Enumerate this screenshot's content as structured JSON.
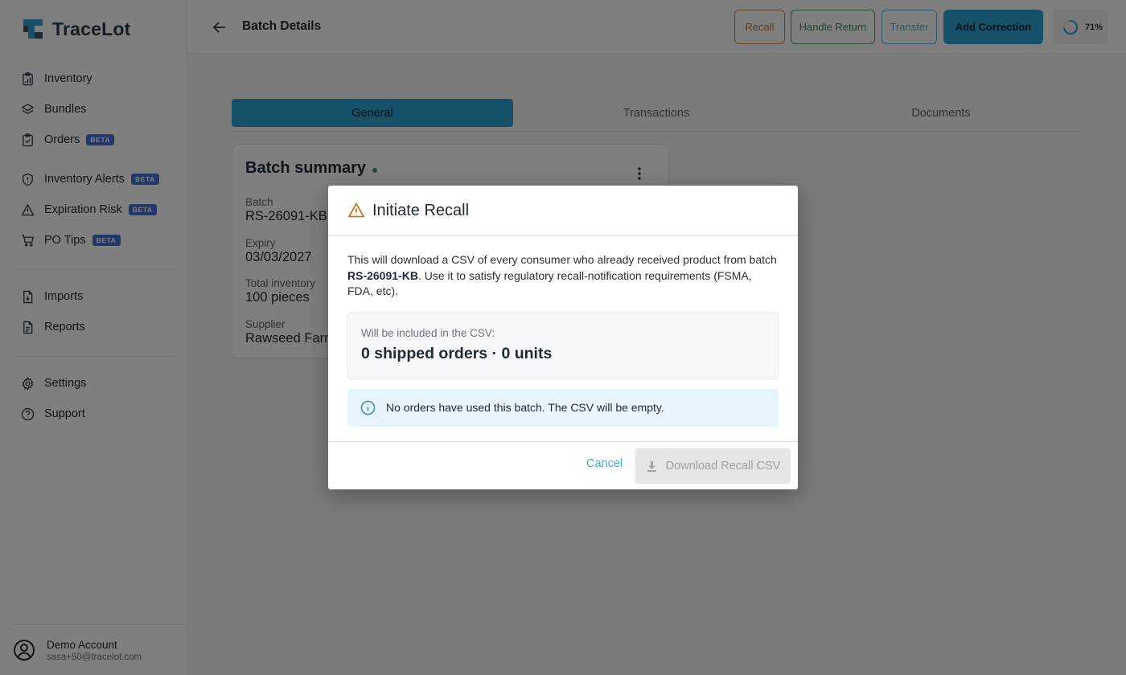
{
  "app": {
    "name": "TraceLot"
  },
  "sidebar": {
    "groups": [
      [
        {
          "label": "Inventory",
          "icon": "clipboard-icon",
          "beta": false
        },
        {
          "label": "Bundles",
          "icon": "layers-icon",
          "beta": false
        },
        {
          "label": "Orders",
          "icon": "clipboard-check-icon",
          "beta": true
        }
      ],
      [
        {
          "label": "Inventory Alerts",
          "icon": "shield-icon",
          "beta": true
        },
        {
          "label": "Expiration Risk",
          "icon": "warning-icon",
          "beta": true
        },
        {
          "label": "PO Tips",
          "icon": "cart-icon",
          "beta": true
        }
      ],
      [
        {
          "label": "Imports",
          "icon": "file-import-icon",
          "beta": false
        },
        {
          "label": "Reports",
          "icon": "file-report-icon",
          "beta": false
        }
      ],
      [
        {
          "label": "Settings",
          "icon": "gear-icon",
          "beta": false
        },
        {
          "label": "Support",
          "icon": "help-icon",
          "beta": false
        }
      ]
    ],
    "beta_label": "BETA",
    "account": {
      "name": "Demo Account",
      "email": "sasa+50@tracelot.com"
    }
  },
  "header": {
    "title": "Batch Details",
    "buttons": {
      "recall": "Recall",
      "handle_return": "Handle Return",
      "transfer": "Transfer",
      "add_correction": "Add Correction"
    },
    "progress": {
      "value": 71,
      "label": "71%"
    }
  },
  "tabs": {
    "general": "General",
    "transactions": "Transactions",
    "documents": "Documents"
  },
  "card": {
    "title": "Batch summary",
    "fields": {
      "batch": {
        "label": "Batch",
        "value": "RS-26091-KB"
      },
      "expiry": {
        "label": "Expiry",
        "value": "03/03/2027"
      },
      "inventory": {
        "label": "Total inventory",
        "value": "100 pieces"
      },
      "supplier": {
        "label": "Supplier",
        "value": "Rawseed Farm"
      }
    }
  },
  "modal": {
    "title": "Initiate Recall",
    "desc_before": "This will download a CSV of every consumer who already received product from batch ",
    "desc_batch": "RS-26091-KB",
    "desc_after": ". Use it to satisfy regulatory recall-notification requirements (FSMA, FDA, etc).",
    "summary_label": "Will be included in the CSV:",
    "summary_value": "0 shipped orders · 0 units",
    "info_text": "No orders have used this batch. The CSV will be empty.",
    "cancel": "Cancel",
    "download": "Download Recall CSV"
  },
  "colors": {
    "accent": "#2fa0d3",
    "recall": "#c9762a",
    "return": "#3f9160",
    "transfer": "#3fb0d8",
    "beta": "#4a6fd1"
  }
}
